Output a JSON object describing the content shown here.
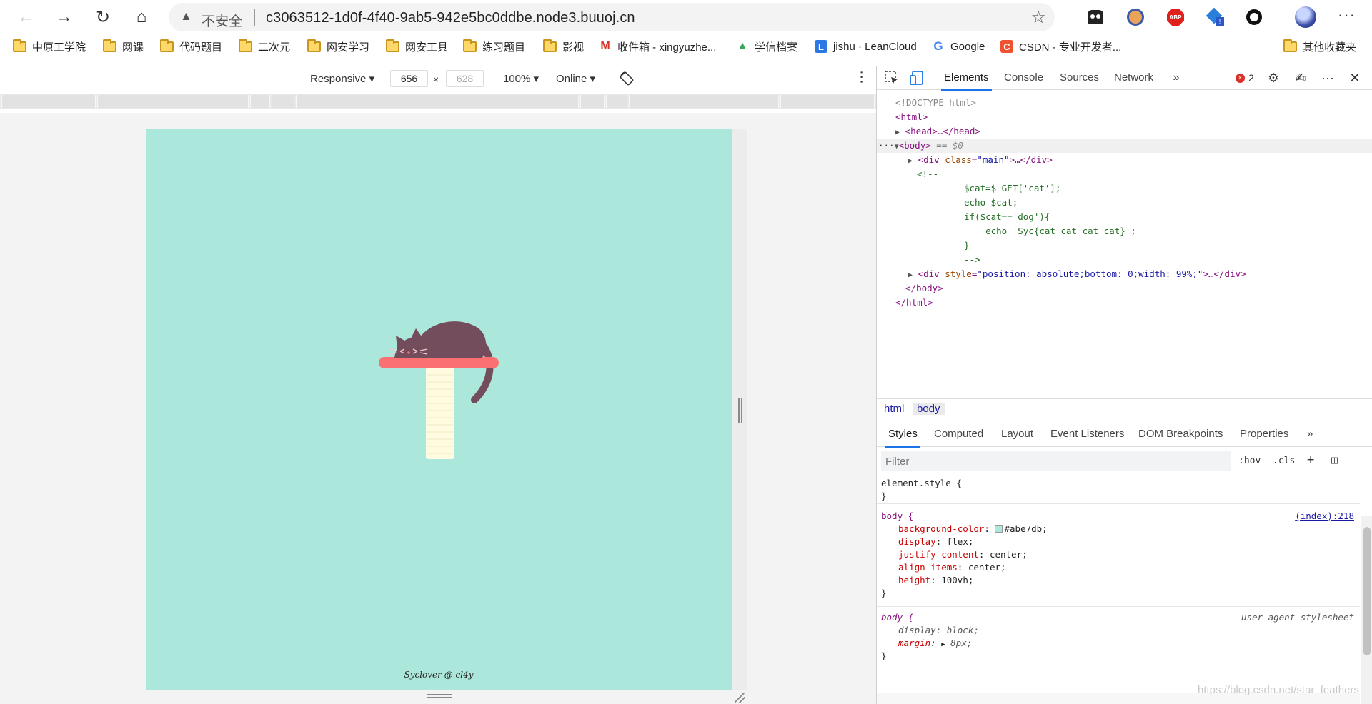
{
  "browser": {
    "security_label": "不安全",
    "url": "c3063512-1d0f-4f40-9ab5-942e5bc0ddbe.node3.buuoj.cn"
  },
  "bookmarks": [
    {
      "label": "中原工学院",
      "icon": "folder-icon"
    },
    {
      "label": "网课",
      "icon": "folder-icon"
    },
    {
      "label": "代码题目",
      "icon": "folder-icon"
    },
    {
      "label": "二次元",
      "icon": "folder-icon"
    },
    {
      "label": "网安学习",
      "icon": "folder-icon"
    },
    {
      "label": "网安工具",
      "icon": "folder-icon"
    },
    {
      "label": "练习题目",
      "icon": "folder-icon"
    },
    {
      "label": "影视",
      "icon": "folder-icon"
    },
    {
      "label": "收件箱 - xingyuzhe...",
      "icon": "gmail-icon"
    },
    {
      "label": "学信档案",
      "icon": "chsi-icon"
    },
    {
      "label": "jishu · LeanCloud",
      "icon": "leancloud-icon"
    },
    {
      "label": "Google",
      "icon": "google-icon"
    },
    {
      "label": "CSDN - 专业开发者...",
      "icon": "csdn-icon"
    },
    {
      "label": "其他收藏夹",
      "icon": "folder-icon"
    }
  ],
  "device_toolbar": {
    "mode": "Responsive",
    "width": "656",
    "height_placeholder": "628",
    "zoom": "100%",
    "throttle": "Online"
  },
  "page": {
    "background": "#abe7db",
    "credit": "Syclover @ cl4y"
  },
  "devtools": {
    "tabs": [
      "Elements",
      "Console",
      "Sources",
      "Network"
    ],
    "active_tab": "Elements",
    "error_count": "2",
    "dom": {
      "doctype": "<!DOCTYPE html>",
      "html_open": "<html>",
      "head": "<head>…</head>",
      "body_open": "<body>",
      "body_marker": " == $0",
      "div_main_tag": "div",
      "div_main_attr": "class",
      "div_main_val": "\"main\"",
      "ellipsis_close": ">…</div>",
      "comment_open": "<!--",
      "comment_lines": [
        "$cat=$_GET['cat'];",
        "echo $cat;",
        "if($cat=='dog'){",
        "    echo 'Syc{cat_cat_cat_cat}';",
        "}",
        "-->"
      ],
      "div_style_tag": "div",
      "div_style_attr": "style",
      "div_style_val": "\"position: absolute;bottom: 0;width: 99%;\"",
      "body_close": "</body>",
      "html_close": "</html>"
    },
    "breadcrumbs": [
      "html",
      "body"
    ],
    "styles_tabs": [
      "Styles",
      "Computed",
      "Layout",
      "Event Listeners",
      "DOM Breakpoints",
      "Properties"
    ],
    "active_styles_tab": "Styles",
    "filter_placeholder": "Filter",
    "hov_label": ":hov",
    "cls_label": ".cls",
    "rules": {
      "element_style": "element.style {",
      "close_brace": "}",
      "body_selector": "body {",
      "body_source": "(index):218",
      "body_props": [
        {
          "name": "background-color",
          "value": "#abe7db;"
        },
        {
          "name": "display",
          "value": "flex;"
        },
        {
          "name": "justify-content",
          "value": "center;"
        },
        {
          "name": "align-items",
          "value": "center;"
        },
        {
          "name": "height",
          "value": "100vh;"
        }
      ],
      "ua_selector": "body {",
      "ua_source": "user agent stylesheet",
      "ua_struck": "display: block;",
      "ua_margin_name": "margin",
      "ua_margin_value": "8px;"
    }
  },
  "watermark": "https://blog.csdn.net/star_feathers"
}
